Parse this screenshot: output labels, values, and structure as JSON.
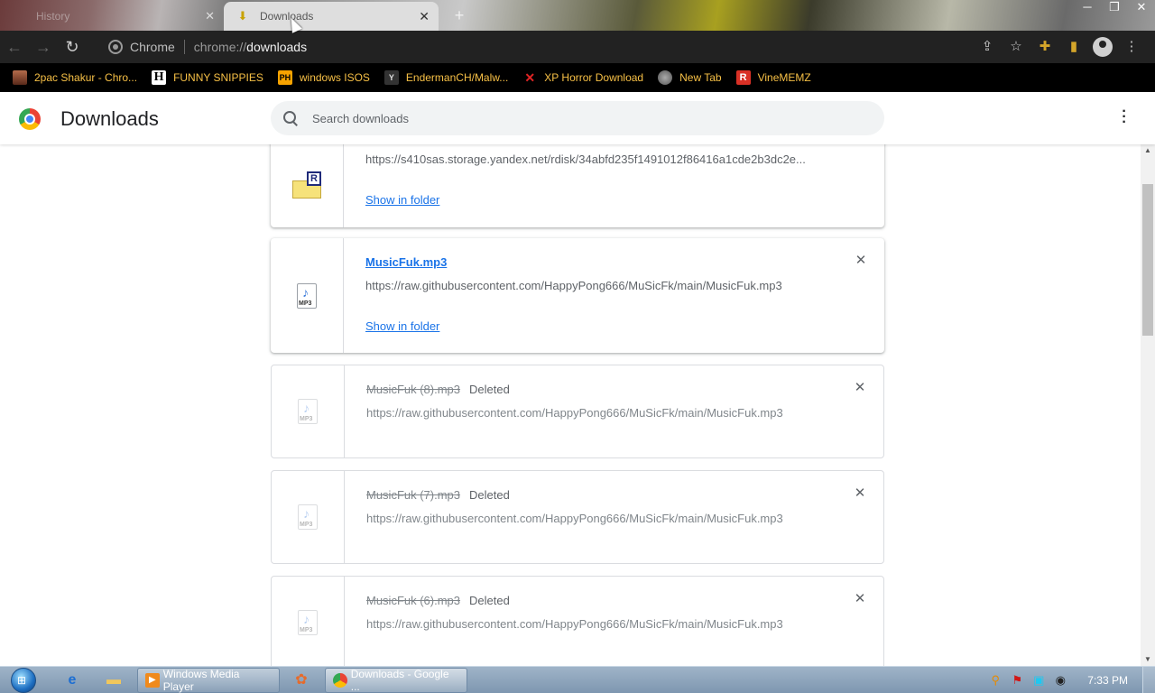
{
  "tabs": [
    {
      "title": "History",
      "active": false
    },
    {
      "title": "Downloads",
      "active": true
    }
  ],
  "window_controls": [
    "─",
    "❐",
    "✕"
  ],
  "omnibox": {
    "chip": "Chrome",
    "scheme": "chrome://",
    "host": "downloads"
  },
  "bookmarks": [
    {
      "label": "2pac Shakur - Chro...",
      "icon": "image-icon"
    },
    {
      "label": "FUNNY SNIPPIES",
      "icon": "h-icon"
    },
    {
      "label": "windows ISOS",
      "icon": "ph-icon"
    },
    {
      "label": "EndermanCH/Malw...",
      "icon": "y-icon"
    },
    {
      "label": "XP Horror Download",
      "icon": "x-icon"
    },
    {
      "label": "New Tab",
      "icon": "globe-icon"
    },
    {
      "label": "VineMEMZ",
      "icon": "r-icon"
    }
  ],
  "header": {
    "title": "Downloads",
    "search_placeholder": "Search downloads"
  },
  "downloads": [
    {
      "name": "",
      "url": "https://s410sas.storage.yandex.net/rdisk/34abfd235f1491012f86416a1cde2b3dc2e...",
      "show_in_folder": "Show in folder",
      "status": "",
      "deleted": false,
      "icon": "rar-archive-icon"
    },
    {
      "name": "MusicFuk.mp3",
      "url": "https://raw.githubusercontent.com/HappyPong666/MuSicFk/main/MusicFuk.mp3",
      "show_in_folder": "Show in folder",
      "status": "",
      "deleted": false,
      "icon": "mp3-file-icon"
    },
    {
      "name": "MusicFuk (8).mp3",
      "url": "https://raw.githubusercontent.com/HappyPong666/MuSicFk/main/MusicFuk.mp3",
      "status": "Deleted",
      "deleted": true,
      "icon": "mp3-file-icon"
    },
    {
      "name": "MusicFuk (7).mp3",
      "url": "https://raw.githubusercontent.com/HappyPong666/MuSicFk/main/MusicFuk.mp3",
      "status": "Deleted",
      "deleted": true,
      "icon": "mp3-file-icon"
    },
    {
      "name": "MusicFuk (6).mp3",
      "url": "https://raw.githubusercontent.com/HappyPong666/MuSicFk/main/MusicFuk.mp3",
      "status": "Deleted",
      "deleted": true,
      "icon": "mp3-file-icon"
    }
  ],
  "taskbar": {
    "buttons": [
      {
        "label": "Windows Media Player"
      },
      {
        "label": "Downloads - Google ..."
      }
    ],
    "clock": "7:33 PM"
  },
  "colors": {
    "link": "#1a73e8",
    "toolbar": "#222222",
    "bookmark_text": "#f7c046"
  }
}
